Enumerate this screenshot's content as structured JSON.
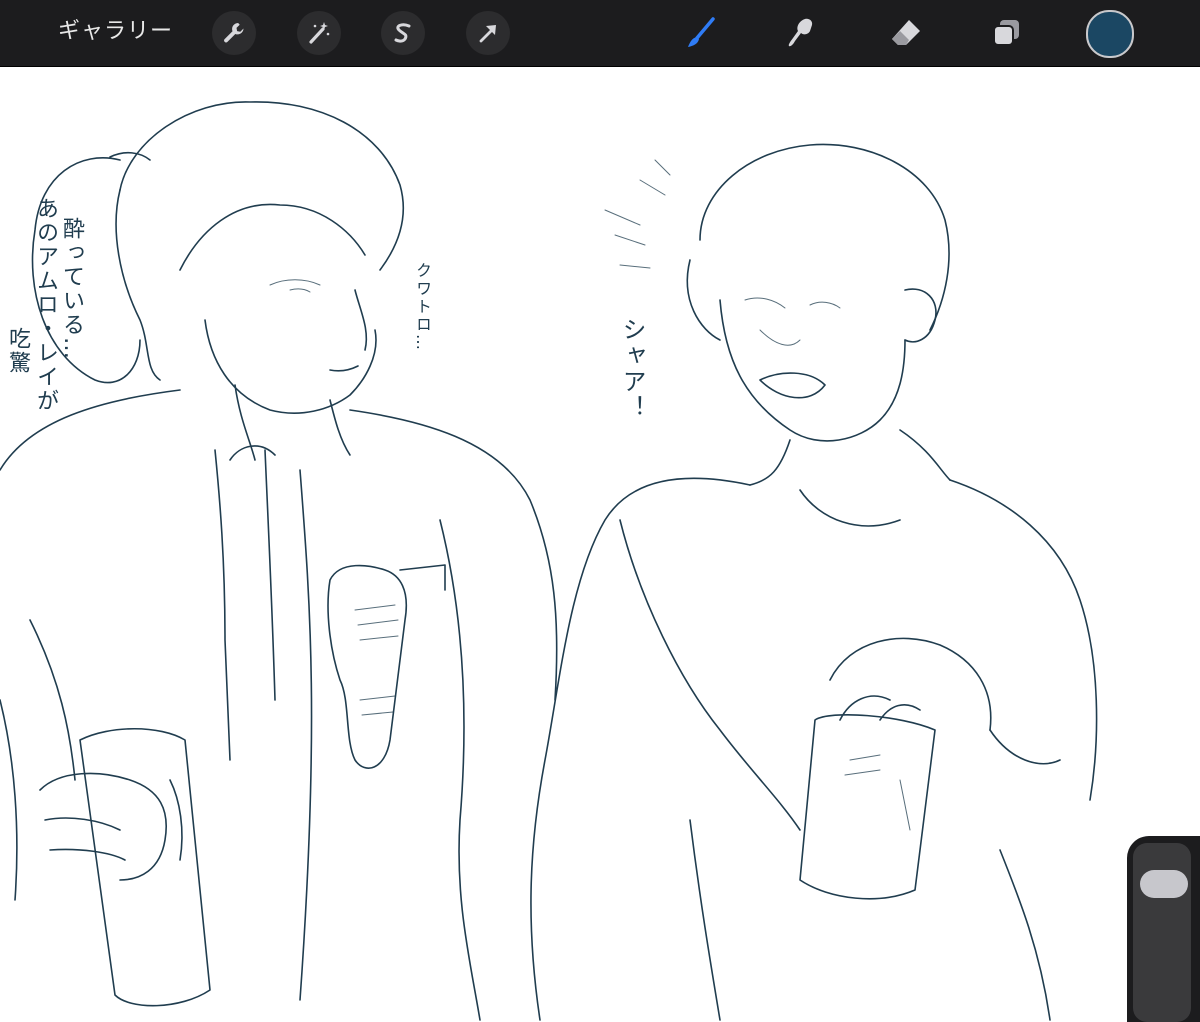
{
  "toolbar": {
    "gallery_label": "ギャラリー",
    "left_tools": [
      "wrench-icon",
      "magic-wand-icon",
      "selection-s-icon",
      "transform-arrow-icon"
    ],
    "right_tools": [
      "brush-icon",
      "smudge-icon",
      "eraser-icon",
      "layers-icon"
    ],
    "active_tool": "brush-icon",
    "active_color": "#1b4763",
    "accent_color": "#2f7cf6"
  },
  "canvas": {
    "notes": {
      "bubble_text_1": "あのアムロ・レイが",
      "bubble_text_2": "酔っている…",
      "exclaim": "吃驚",
      "sfx": "クワトロ…",
      "shout": "シャア！"
    }
  }
}
